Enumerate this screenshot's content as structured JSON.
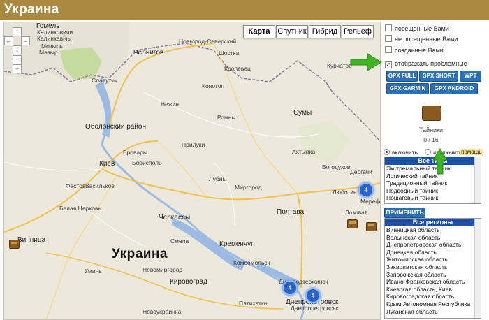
{
  "header": {
    "title": "Украина"
  },
  "map": {
    "types": [
      "Карта",
      "Спутник",
      "Гибрид",
      "Рельеф"
    ],
    "active_type": "Карта",
    "cities": [
      {
        "name": "Гомель",
        "cls": "big"
      },
      {
        "name": "Калинковичи"
      },
      {
        "name": "Калинкавічы"
      },
      {
        "name": "Мозырь"
      },
      {
        "name": "Мазыр"
      },
      {
        "name": "Новгород-Северский"
      },
      {
        "name": "Шостка"
      },
      {
        "name": "Чернигов",
        "cls": "big"
      },
      {
        "name": "Славутич"
      },
      {
        "name": "Кролевец"
      },
      {
        "name": "Нежин"
      },
      {
        "name": "Конотоп"
      },
      {
        "name": "Оболонский район"
      },
      {
        "name": "Киев",
        "cls": "big"
      },
      {
        "name": "Ромны"
      },
      {
        "name": "Сумы",
        "cls": "big"
      },
      {
        "name": "Курчатов"
      },
      {
        "name": "Бровары"
      },
      {
        "name": "Борисполь"
      },
      {
        "name": "Прилуки"
      },
      {
        "name": "Белая Церковь"
      },
      {
        "name": "Васильков"
      },
      {
        "name": "Фастов"
      },
      {
        "name": "Лубны"
      },
      {
        "name": "Миргород"
      },
      {
        "name": "Полтава",
        "cls": "big"
      },
      {
        "name": "Ахтырка"
      },
      {
        "name": "Богодухов"
      },
      {
        "name": "Лозовая"
      },
      {
        "name": "Черкассы",
        "cls": "big"
      },
      {
        "name": "Умань"
      },
      {
        "name": "Кременчуг",
        "cls": "big"
      },
      {
        "name": "Смела"
      },
      {
        "name": "Винница",
        "cls": "big"
      },
      {
        "name": "Кировоград",
        "cls": "big"
      },
      {
        "name": "Днепродзержинск"
      },
      {
        "name": "Днепропетровск",
        "cls": "big"
      },
      {
        "name": "Днепропетровськ"
      },
      {
        "name": "Новоукраинка"
      },
      {
        "name": "Пятихатки"
      },
      {
        "name": "Новомиргород"
      },
      {
        "name": "Люботин"
      },
      {
        "name": "Мерефа"
      },
      {
        "name": "Дергачи"
      },
      {
        "name": "Комсомольск"
      },
      {
        "name": "Украина",
        "cls": "country"
      }
    ],
    "clusters": [
      "4",
      "4",
      "4"
    ]
  },
  "sidebar": {
    "filters": [
      {
        "label": "посещенные Вами",
        "checked": false
      },
      {
        "label": "не посещенные Вами",
        "checked": false
      },
      {
        "label": "созданные Вами",
        "checked": false
      },
      {
        "label": "отображать проблемные",
        "checked": true
      }
    ],
    "gpx_buttons": [
      "GPX FULL",
      "GPX SHORT",
      "WPT",
      "GPX GARMIN",
      "GPX ANDROID"
    ],
    "caches_label": "Тайники",
    "caches_count": "0 / 16",
    "radio_include": "включить",
    "radio_exclude": "исключить",
    "help": "помощь",
    "types_header": "Все типы",
    "types": [
      "Экстремальный тайник",
      "Логический тайник",
      "Традиционный тайник",
      "Подводный тайник",
      "Пошаговый тайник"
    ],
    "apply_label": "ПРИМЕНИТЬ",
    "regions_header": "Все регионы",
    "regions": [
      "Винницкая область",
      "Волынская область",
      "Днепропетровская область",
      "Донецкая область",
      "Житомирская область",
      "Закарпатская область",
      "Запорожская область",
      "Ивано-Франковская область",
      "Киевская область, Киев",
      "Кировоградская область",
      "Крым Автономная Республика",
      "Луганская область"
    ]
  }
}
